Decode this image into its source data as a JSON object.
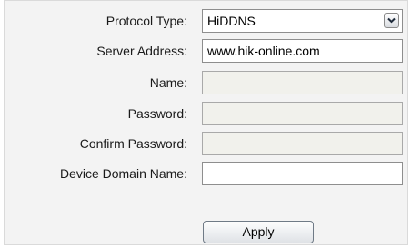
{
  "form": {
    "protocol_type": {
      "label": "Protocol Type:",
      "value": "HiDDNS",
      "icon": "chevron-down-icon"
    },
    "server_address": {
      "label": "Server Address:",
      "value": "www.hik-online.com"
    },
    "name": {
      "label": "Name:",
      "value": "",
      "enabled": false
    },
    "password": {
      "label": "Password:",
      "value": "",
      "enabled": false
    },
    "confirm_password": {
      "label": "Confirm Password:",
      "value": "",
      "enabled": false
    },
    "device_domain_name": {
      "label": "Device Domain Name:",
      "value": ""
    }
  },
  "actions": {
    "apply_label": "Apply"
  }
}
